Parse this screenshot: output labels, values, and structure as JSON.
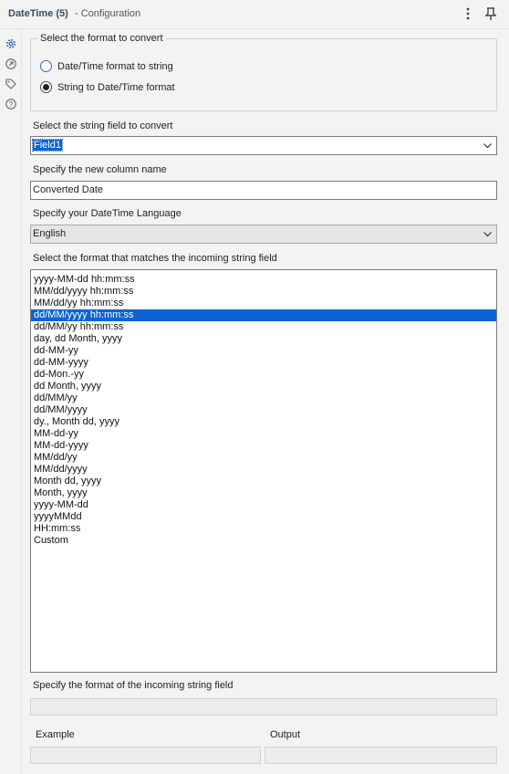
{
  "window": {
    "title": "DateTime (5)",
    "subtitle": "- Configuration"
  },
  "rail_icons": [
    "gear-icon",
    "arrow-circle-icon",
    "tag-icon",
    "help-icon"
  ],
  "format_group": {
    "legend": "Select the format to convert",
    "options": [
      {
        "label": "Date/Time format to string",
        "checked": false
      },
      {
        "label": "String to Date/Time format",
        "checked": true
      }
    ]
  },
  "field_select": {
    "label": "Select the string field to convert",
    "value": "Field1"
  },
  "column_name": {
    "label": "Specify the new column name",
    "value": "Converted Date"
  },
  "language": {
    "label": "Specify your DateTime Language",
    "value": "English"
  },
  "format_list": {
    "label": "Select the format that matches the incoming string field",
    "selected_index": 3,
    "items": [
      "yyyy-MM-dd hh:mm:ss",
      "MM/dd/yyyy hh:mm:ss",
      "MM/dd/yy hh:mm:ss",
      "dd/MM/yyyy hh:mm:ss",
      "dd/MM/yy hh:mm:ss",
      "day, dd Month, yyyy",
      "dd-MM-yy",
      "dd-MM-yyyy",
      "dd-Mon.-yy",
      "dd Month, yyyy",
      "dd/MM/yy",
      "dd/MM/yyyy",
      "dy., Month dd, yyyy",
      "MM-dd-yy",
      "MM-dd-yyyy",
      "MM/dd/yy",
      "MM/dd/yyyy",
      "Month dd, yyyy",
      "Month, yyyy",
      "yyyy-MM-dd",
      "yyyyMMdd",
      "HH:mm:ss",
      "Custom"
    ]
  },
  "incoming_format": {
    "label": "Specify the format of the incoming string field",
    "value": ""
  },
  "preview": {
    "example_label": "Example",
    "output_label": "Output",
    "example_value": "",
    "output_value": ""
  }
}
